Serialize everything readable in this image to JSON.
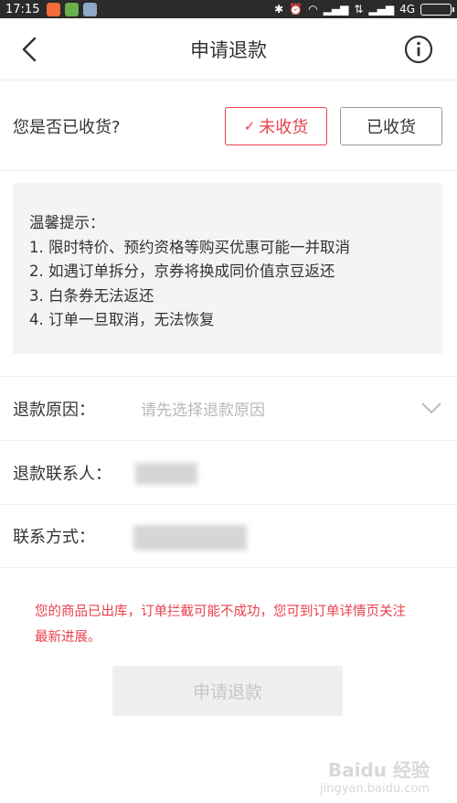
{
  "statusbar": {
    "time": "17:15",
    "network": "4G",
    "app_icon_colors": [
      "#f26b3a",
      "#6ab04c",
      "#8fa8c8"
    ]
  },
  "header": {
    "title": "申请退款",
    "back_icon": "chevron-left-icon",
    "info_icon": "info-circle-icon"
  },
  "received": {
    "label": "您是否已收货?",
    "options": [
      {
        "label": "未收货",
        "selected": true
      },
      {
        "label": "已收货",
        "selected": false
      }
    ]
  },
  "tips": {
    "lines": [
      "温馨提示：",
      "1. 限时特价、预约资格等购买优惠可能一并取消",
      "2. 如遇订单拆分，京券将换成同价值京豆返还",
      "3. 白条券无法返还",
      "4. 订单一旦取消，无法恢复"
    ]
  },
  "form": {
    "reason_label": "退款原因：",
    "reason_placeholder": "请先选择退款原因",
    "contact_label": "退款联系人：",
    "phone_label": "联系方式："
  },
  "notice": "您的商品已出库，订单拦截可能不成功，您可到订单详情页关注最新进展。",
  "submit_label": "申请退款",
  "watermark": {
    "main": "Baidu 经验",
    "sub": "jingyan.baidu.com"
  },
  "colors": {
    "accent": "#e9414d",
    "tip_bg": "#f4f4f4",
    "disabled_btn": "#efefef"
  }
}
